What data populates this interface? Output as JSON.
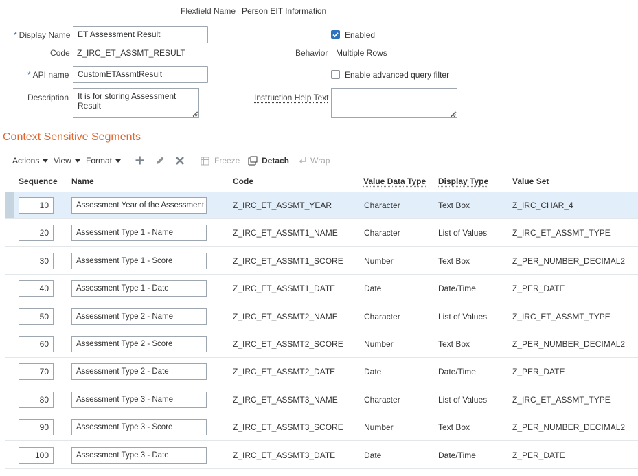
{
  "header": {
    "flexfield_label": "Flexfield Name",
    "flexfield_value": "Person EIT Information"
  },
  "form": {
    "display_name_label": "Display Name",
    "display_name_value": "ET Assessment Result",
    "enabled_label": "Enabled",
    "enabled_checked": true,
    "code_label": "Code",
    "code_value": "Z_IRC_ET_ASSMT_RESULT",
    "behavior_label": "Behavior",
    "behavior_value": "Multiple Rows",
    "api_name_label": "API name",
    "api_name_value": "CustomETAssmtResult",
    "adv_query_label": "Enable advanced query filter",
    "adv_query_checked": false,
    "description_label": "Description",
    "description_value": "It is for storing Assessment Result",
    "instruction_label": "Instruction Help Text",
    "instruction_value": "",
    "required_mark": "*"
  },
  "section": {
    "title": "Context Sensitive Segments"
  },
  "toolbar": {
    "actions": "Actions",
    "view": "View",
    "format": "Format",
    "add_icon": "plus-icon",
    "edit_icon": "pencil-icon",
    "delete_icon": "x-icon",
    "freeze": "Freeze",
    "detach": "Detach",
    "wrap": "Wrap"
  },
  "table": {
    "columns": [
      "Sequence",
      "Name",
      "Code",
      "Value Data Type",
      "Display Type",
      "Value Set"
    ],
    "rows": [
      {
        "seq": "10",
        "name": "Assessment Year of the Assessment",
        "code": "Z_IRC_ET_ASSMT_YEAR",
        "type": "Character",
        "display": "Text Box",
        "valueset": "Z_IRC_CHAR_4",
        "selected": true
      },
      {
        "seq": "20",
        "name": "Assessment Type 1 - Name",
        "code": "Z_IRC_ET_ASSMT1_NAME",
        "type": "Character",
        "display": "List of Values",
        "valueset": "Z_IRC_ET_ASSMT_TYPE"
      },
      {
        "seq": "30",
        "name": "Assessment Type 1 - Score",
        "code": "Z_IRC_ET_ASSMT1_SCORE",
        "type": "Number",
        "display": "Text Box",
        "valueset": "Z_PER_NUMBER_DECIMAL2"
      },
      {
        "seq": "40",
        "name": "Assessment Type 1 - Date",
        "code": "Z_IRC_ET_ASSMT1_DATE",
        "type": "Date",
        "display": "Date/Time",
        "valueset": "Z_PER_DATE"
      },
      {
        "seq": "50",
        "name": "Assessment Type 2 - Name",
        "code": "Z_IRC_ET_ASSMT2_NAME",
        "type": "Character",
        "display": "List of Values",
        "valueset": "Z_IRC_ET_ASSMT_TYPE"
      },
      {
        "seq": "60",
        "name": "Assessment Type 2 - Score",
        "code": "Z_IRC_ET_ASSMT2_SCORE",
        "type": "Number",
        "display": "Text Box",
        "valueset": "Z_PER_NUMBER_DECIMAL2"
      },
      {
        "seq": "70",
        "name": "Assessment Type 2 - Date",
        "code": "Z_IRC_ET_ASSMT2_DATE",
        "type": "Date",
        "display": "Date/Time",
        "valueset": "Z_PER_DATE"
      },
      {
        "seq": "80",
        "name": "Assessment Type 3 - Name",
        "code": "Z_IRC_ET_ASSMT3_NAME",
        "type": "Character",
        "display": "List of Values",
        "valueset": "Z_IRC_ET_ASSMT_TYPE"
      },
      {
        "seq": "90",
        "name": "Assessment Type 3 - Score",
        "code": "Z_IRC_ET_ASSMT3_SCORE",
        "type": "Number",
        "display": "Text Box",
        "valueset": "Z_PER_NUMBER_DECIMAL2"
      },
      {
        "seq": "100",
        "name": "Assessment Type 3 - Date",
        "code": "Z_IRC_ET_ASSMT3_DATE",
        "type": "Date",
        "display": "Date/Time",
        "valueset": "Z_PER_DATE"
      }
    ]
  },
  "colors": {
    "accent": "#e0662f",
    "selected_row": "#e2eef9",
    "checkbox_on": "#2f73bd"
  }
}
